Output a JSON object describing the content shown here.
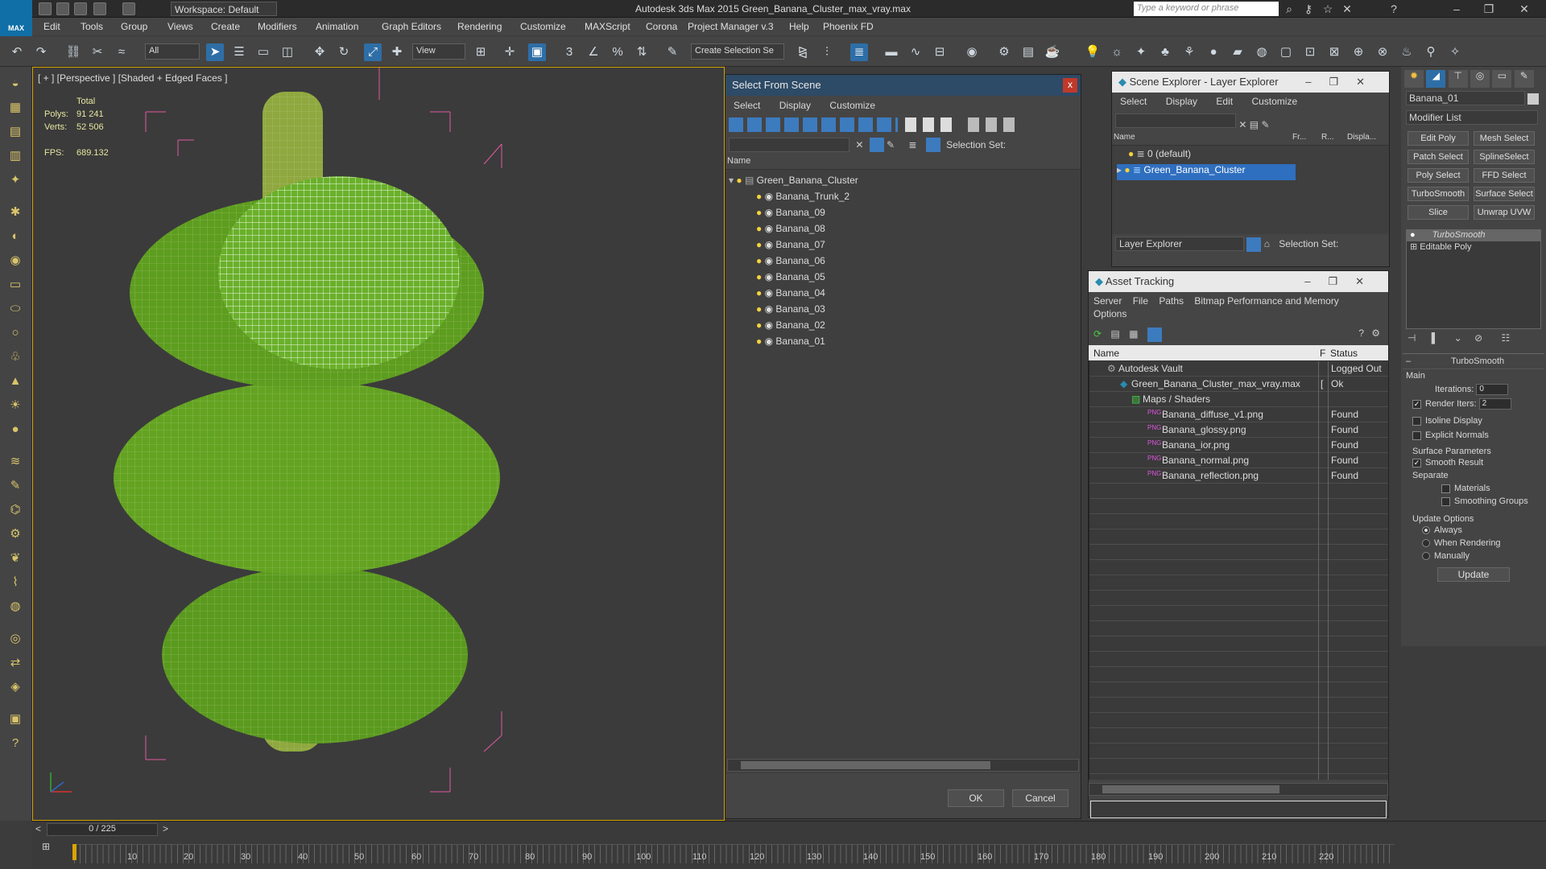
{
  "app": {
    "title": "Autodesk 3ds Max  2015    Green_Banana_Cluster_max_vray.max",
    "workspace": "Workspace: Default",
    "search_placeholder": "Type a keyword or phrase",
    "logo": "MAX"
  },
  "menu": [
    "Edit",
    "Tools",
    "Group",
    "Views",
    "Create",
    "Modifiers",
    "Animation",
    "Graph Editors",
    "Rendering",
    "Customize",
    "MAXScript",
    "Corona",
    "Project Manager v.3",
    "Help",
    "Phoenix FD"
  ],
  "toolbar": {
    "filter": "All",
    "ref_coord": "View",
    "selection_set": "Create Selection Se"
  },
  "viewport": {
    "label": "[ + ] [Perspective ] [Shaded + Edged Faces ]",
    "total_label": "Total",
    "polys_label": "Polys:",
    "polys": "91 241",
    "verts_label": "Verts:",
    "verts": "52 506",
    "fps_label": "FPS:",
    "fps": "689.132"
  },
  "select_from_scene": {
    "title": "Select From Scene",
    "close": "x",
    "menu": [
      "Select",
      "Display",
      "Customize"
    ],
    "selection_set_label": "Selection Set:",
    "col_name": "Name",
    "root": "Green_Banana_Cluster",
    "items": [
      "Banana_Trunk_2",
      "Banana_09",
      "Banana_08",
      "Banana_07",
      "Banana_06",
      "Banana_05",
      "Banana_04",
      "Banana_03",
      "Banana_02",
      "Banana_01"
    ],
    "ok": "OK",
    "cancel": "Cancel"
  },
  "scene_explorer": {
    "title": "Scene Explorer - Layer Explorer",
    "menu": [
      "Select",
      "Display",
      "Edit",
      "Customize"
    ],
    "cols": [
      "Name",
      "Fr...",
      "R...",
      "Displa..."
    ],
    "rows": [
      "0 (default)",
      "Green_Banana_Cluster"
    ],
    "footer_dropdown": "Layer Explorer",
    "selection_set_label": "Selection Set:"
  },
  "asset_tracking": {
    "title": "Asset Tracking",
    "menu": [
      "Server",
      "File",
      "Paths",
      "Bitmap Performance and Memory"
    ],
    "menu2": "Options",
    "cols": [
      "Name",
      "F",
      "Status"
    ],
    "rows": [
      {
        "name": "Autodesk Vault",
        "f": "",
        "status": "Logged Out"
      },
      {
        "name": "Green_Banana_Cluster_max_vray.max",
        "f": "[",
        "status": "Ok"
      },
      {
        "name": "Maps / Shaders",
        "f": "",
        "status": ""
      },
      {
        "name": "Banana_diffuse_v1.png",
        "f": "",
        "status": "Found"
      },
      {
        "name": "Banana_glossy.png",
        "f": "",
        "status": "Found"
      },
      {
        "name": "Banana_ior.png",
        "f": "",
        "status": "Found"
      },
      {
        "name": "Banana_normal.png",
        "f": "",
        "status": "Found"
      },
      {
        "name": "Banana_reflection.png",
        "f": "",
        "status": "Found"
      }
    ]
  },
  "command_panel": {
    "object_name": "Banana_01",
    "modifier_list": "Modifier List",
    "buttons": [
      "Edit Poly",
      "Mesh Select",
      "Patch Select",
      "SplineSelect",
      "Poly Select",
      "FFD Select",
      "TurboSmooth",
      "Surface Select",
      "Slice",
      "Unwrap UVW"
    ],
    "stack": [
      "TurboSmooth",
      "Editable Poly"
    ],
    "rollout_title": "TurboSmooth",
    "main": "Main",
    "iterations_label": "Iterations:",
    "iterations": "0",
    "render_iters_label": "Render Iters:",
    "render_iters": "2",
    "isoline": "Isoline Display",
    "explicit": "Explicit Normals",
    "surface_params": "Surface Parameters",
    "smooth_result": "Smooth Result",
    "separate": "Separate",
    "materials": "Materials",
    "smoothing_groups": "Smoothing Groups",
    "update_options": "Update Options",
    "always": "Always",
    "when_rendering": "When Rendering",
    "manually": "Manually",
    "update": "Update"
  },
  "timeline": {
    "frame": "0 / 225",
    "ticks": [
      "10",
      "20",
      "30",
      "40",
      "50",
      "60",
      "70",
      "80",
      "90",
      "100",
      "110",
      "120",
      "130",
      "140",
      "150",
      "160",
      "170",
      "180",
      "190",
      "200",
      "210",
      "220"
    ]
  }
}
